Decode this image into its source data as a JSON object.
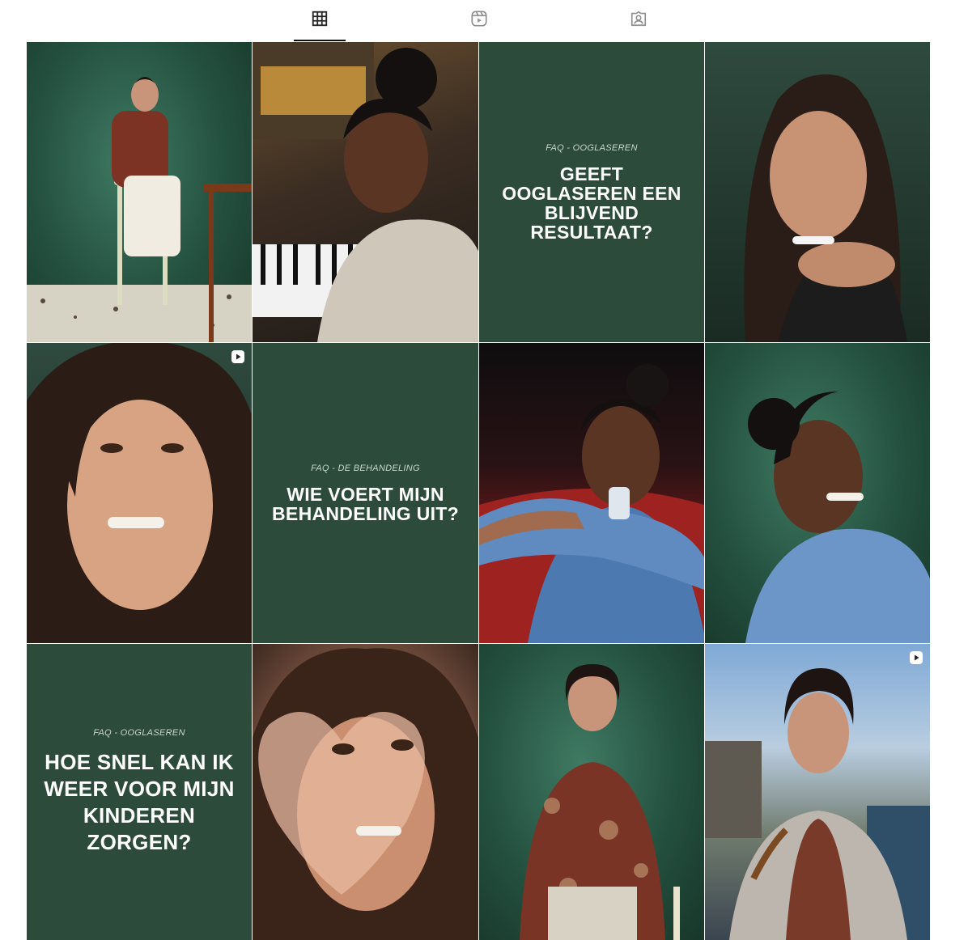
{
  "tabs": [
    {
      "id": "posts",
      "icon": "grid-icon",
      "active": true
    },
    {
      "id": "reels",
      "icon": "reels-icon",
      "active": false
    },
    {
      "id": "tagged",
      "icon": "tagged-icon",
      "active": false
    }
  ],
  "posts": [
    {
      "kind": "photo",
      "icon": "portrait-woman-seated-stool"
    },
    {
      "kind": "photo",
      "icon": "portrait-person-piano"
    },
    {
      "kind": "faq",
      "label": "FAQ - OOGLASEREN",
      "question": "GEEFT OOGLASEREN EEN BLIJVEND RESULTAAT?"
    },
    {
      "kind": "photo",
      "icon": "portrait-woman-hands-chin"
    },
    {
      "kind": "photo",
      "icon": "portrait-woman-closeup",
      "reel": true
    },
    {
      "kind": "faq",
      "label": "FAQ - DE BEHANDELING",
      "question": "WIE VOERT MIJN BEHANDELING UIT?"
    },
    {
      "kind": "photo",
      "icon": "portrait-person-theatre"
    },
    {
      "kind": "photo",
      "icon": "portrait-person-green-backdrop"
    },
    {
      "kind": "faq",
      "label": "FAQ - OOGLASEREN",
      "question": "HOE SNEL KAN IK WEER VOOR MIJN KINDEREN ZORGEN?"
    },
    {
      "kind": "photo",
      "icon": "portrait-woman-heart-hands"
    },
    {
      "kind": "photo",
      "icon": "portrait-woman-standing"
    },
    {
      "kind": "photo",
      "icon": "portrait-woman-outdoors",
      "reel": true
    }
  ],
  "colors": {
    "faq_background": "#2d4b3b",
    "faq_label": "#c9d6cd",
    "faq_text": "#ffffff",
    "active_tab_indicator": "#111111"
  }
}
